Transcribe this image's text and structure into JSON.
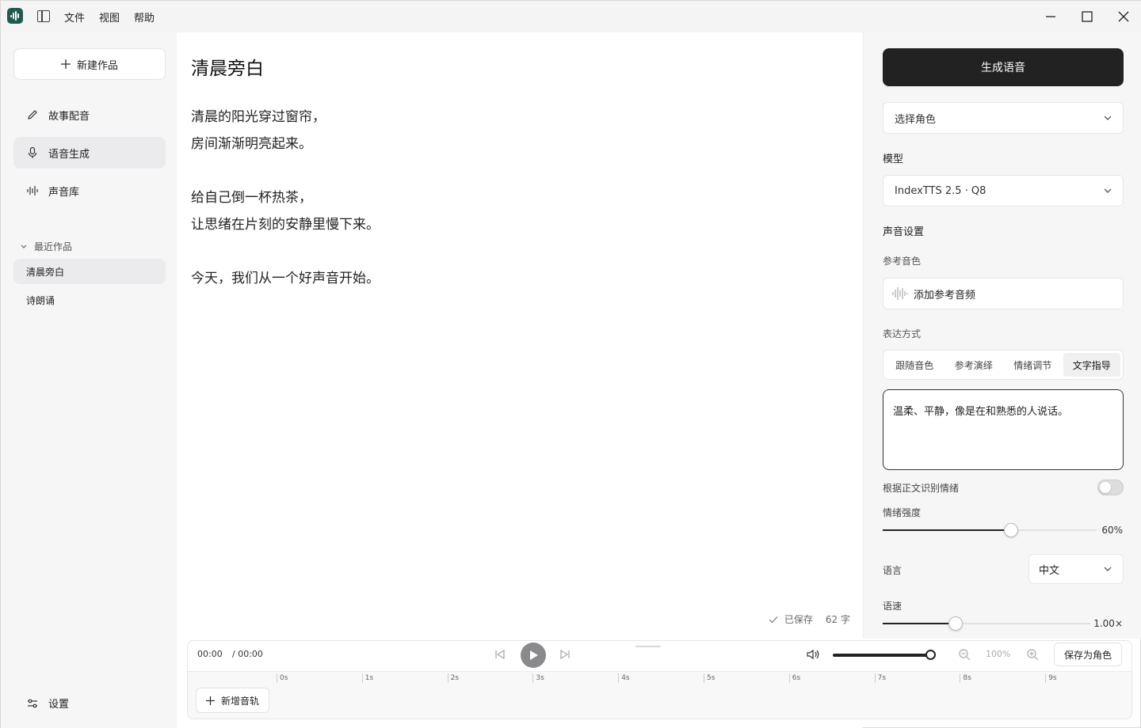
{
  "menu": {
    "file": "文件",
    "view": "视图",
    "help": "帮助"
  },
  "sidebar": {
    "new_work": "新建作品",
    "nav": [
      {
        "label": "故事配音",
        "icon": "pencil-icon"
      },
      {
        "label": "语音生成",
        "icon": "microphone-icon",
        "active": true
      },
      {
        "label": "声音库",
        "icon": "waveform-icon"
      }
    ],
    "recent_title": "最近作品",
    "recent": [
      {
        "label": "清晨旁白",
        "active": true
      },
      {
        "label": "诗朗诵"
      }
    ],
    "settings": "设置"
  },
  "editor": {
    "title": "清晨旁白",
    "paragraphs": [
      [
        "清晨的阳光穿过窗帘，",
        "房间渐渐明亮起来。"
      ],
      [
        "给自己倒一杯热茶，",
        "让思绪在片刻的安静里慢下来。"
      ],
      [
        "今天，我们从一个好声音开始。"
      ]
    ],
    "saved": "已保存",
    "char_count": "62 字"
  },
  "player": {
    "current_time": "00:00",
    "total_time": "/ 00:00",
    "zoom": "100%",
    "save_role": "保存为角色",
    "add_track": "新增音轨",
    "volume": 1.0,
    "ticks": [
      "0s",
      "1s",
      "2s",
      "3s",
      "4s",
      "5s",
      "6s",
      "7s",
      "8s",
      "9s"
    ]
  },
  "panel": {
    "generate": "生成语音",
    "role_placeholder": "选择角色",
    "model_title": "模型",
    "model_value": "IndexTTS 2.5 · Q8",
    "voice_settings": "声音设置",
    "ref_timbre": "参考音色",
    "add_ref_audio": "添加参考音频",
    "expression_title": "表达方式",
    "expression_tabs": [
      "跟随音色",
      "参考演绎",
      "情绪调节",
      "文字指导"
    ],
    "active_tab": 3,
    "guidance_text": "温柔、平静，像是在和熟悉的人说话。",
    "emotion_from_text": "根据正文识别情绪",
    "emotion_from_text_on": false,
    "intensity_label": "情绪强度",
    "intensity_value": "60%",
    "intensity": 0.6,
    "language_label": "语言",
    "language_value": "中文",
    "speed_label": "语速",
    "speed_value": "1.00×",
    "speed": 0.35
  }
}
